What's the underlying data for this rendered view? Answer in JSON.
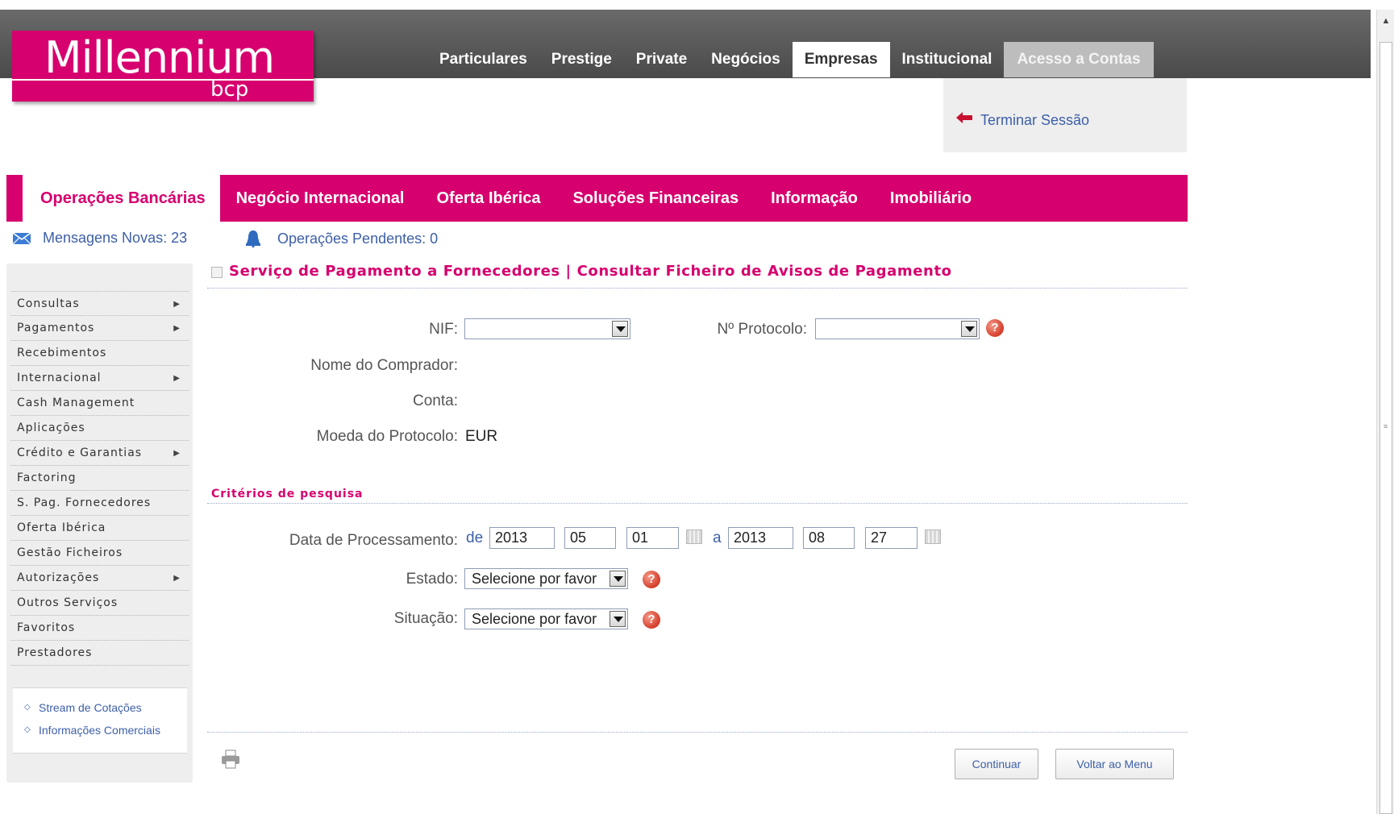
{
  "logo": {
    "main": "Millennium",
    "sub": "bcp"
  },
  "topnav": {
    "items": [
      "Particulares",
      "Prestige",
      "Private",
      "Negócios",
      "Empresas",
      "Institucional"
    ],
    "active": "Empresas",
    "acesso": "Acesso a Contas",
    "terminar_sessao": "Terminar Sessão"
  },
  "pinknav": {
    "items": [
      "Operações Bancárias",
      "Negócio Internacional",
      "Oferta Ibérica",
      "Soluções Financeiras",
      "Informação",
      "Imobiliário"
    ],
    "active": "Operações Bancárias"
  },
  "status": {
    "mensagens_label": "Mensagens Novas:",
    "mensagens_count": "23",
    "pendentes_label": "Operações Pendentes:",
    "pendentes_count": "0"
  },
  "sidebar": {
    "items": [
      {
        "label": "Consultas",
        "has_submenu": true
      },
      {
        "label": "Pagamentos",
        "has_submenu": true
      },
      {
        "label": "Recebimentos",
        "has_submenu": false
      },
      {
        "label": "Internacional",
        "has_submenu": true
      },
      {
        "label": "Cash Management",
        "has_submenu": false
      },
      {
        "label": "Aplicações",
        "has_submenu": false
      },
      {
        "label": "Crédito e Garantias",
        "has_submenu": true
      },
      {
        "label": "Factoring",
        "has_submenu": false
      },
      {
        "label": "S. Pag. Fornecedores",
        "has_submenu": false
      },
      {
        "label": "Oferta Ibérica",
        "has_submenu": false
      },
      {
        "label": "Gestão Ficheiros",
        "has_submenu": false
      },
      {
        "label": "Autorizações",
        "has_submenu": true
      },
      {
        "label": "Outros Serviços",
        "has_submenu": false
      },
      {
        "label": "Favoritos",
        "has_submenu": false
      },
      {
        "label": "Prestadores",
        "has_submenu": false
      }
    ],
    "links": [
      "Stream de Cotações",
      "Informações Comerciais"
    ]
  },
  "main": {
    "title": "Serviço de Pagamento a Fornecedores | Consultar Ficheiro de Avisos de Pagamento",
    "form": {
      "nif_label": "NIF:",
      "nif_value": "",
      "protocolo_label": "Nº Protocolo:",
      "protocolo_value": "",
      "nome_label": "Nome do Comprador:",
      "conta_label": "Conta:",
      "moeda_label": "Moeda do Protocolo:",
      "moeda_value": "EUR"
    },
    "criterios": {
      "title": "Critérios de pesquisa",
      "data_label": "Data de Processamento:",
      "de": "de",
      "a": "a",
      "from": {
        "year": "2013",
        "month": "05",
        "day": "01"
      },
      "to": {
        "year": "2013",
        "month": "08",
        "day": "27"
      },
      "estado_label": "Estado:",
      "estado_value": "Selecione por favor",
      "situacao_label": "Situação:",
      "situacao_value": "Selecione por favor"
    },
    "buttons": {
      "continuar": "Continuar",
      "voltar": "Voltar ao Menu"
    }
  },
  "colors": {
    "brand": "#d6006e",
    "link": "#3d5fa8",
    "topbar": "#555555"
  }
}
